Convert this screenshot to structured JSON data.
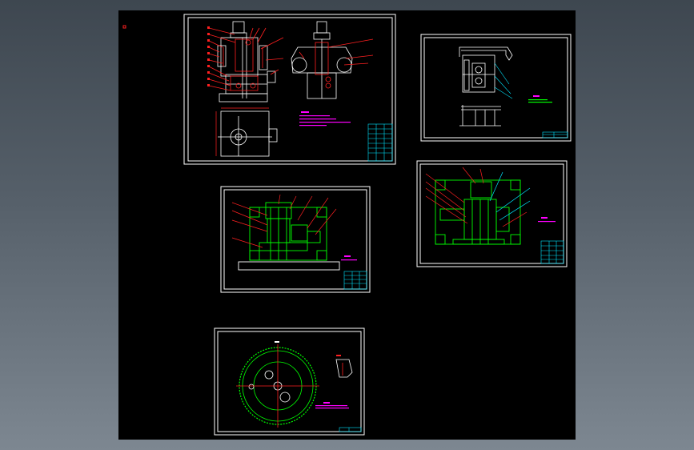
{
  "viewport": {
    "name": "cad-model-space",
    "background": "#000000",
    "outer_background": "#56606a"
  },
  "colors": {
    "white": "#ffffff",
    "red": "#ff2020",
    "green": "#00ff00",
    "cyan": "#00e5ff",
    "magenta": "#ff00ff",
    "yellow": "#ffff00"
  },
  "sheets": [
    {
      "id": "sheet-1",
      "title_block_color": "#00e5ff",
      "content": "assembly-red-section-views"
    },
    {
      "id": "sheet-2",
      "title_block_color": "#00e5ff",
      "content": "part-detail-white"
    },
    {
      "id": "sheet-3",
      "title_block_color": "#00e5ff",
      "content": "assembly-green-front"
    },
    {
      "id": "sheet-4",
      "title_block_color": "#00e5ff",
      "content": "assembly-green-side"
    },
    {
      "id": "sheet-5",
      "title_block_color": "#00e5ff",
      "content": "gear-wheel-detail"
    }
  ],
  "marker": {
    "name": "ucs-marker",
    "color": "#ff2020"
  }
}
